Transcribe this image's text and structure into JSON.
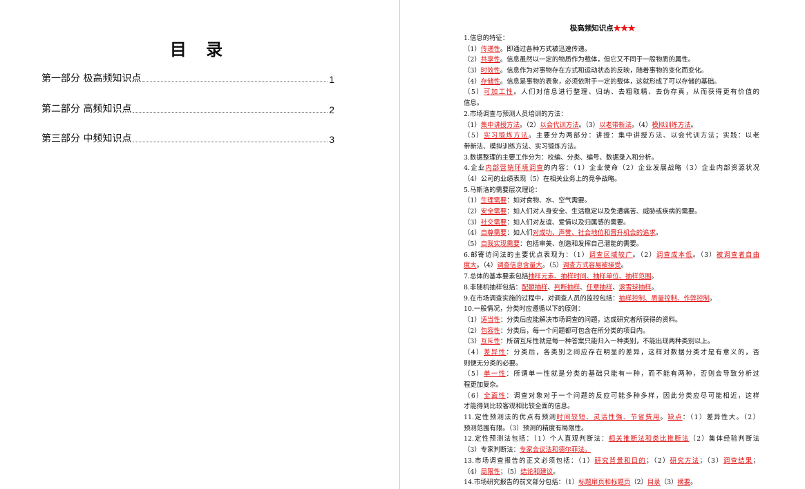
{
  "toc": {
    "title": "目 录",
    "items": [
      {
        "label": "第一部分  极高频知识点",
        "page": "1"
      },
      {
        "label": "第二部分  高频知识点",
        "page": "2"
      },
      {
        "label": "第三部分  中频知识点",
        "page": "3"
      }
    ]
  },
  "doc": {
    "title": "极高频知识点",
    "stars": "★★★",
    "lines": [
      {
        "segs": [
          [
            "1.信息的特征：",
            0
          ]
        ]
      },
      {
        "segs": [
          [
            "（1）",
            0
          ],
          [
            "传递性",
            1
          ],
          [
            "。即通过各种方式被迅速传递。",
            0
          ]
        ]
      },
      {
        "segs": [
          [
            "（2）",
            0
          ],
          [
            "共享性",
            1
          ],
          [
            "。信息虽然以一定的物质作为载体，但它又不同于一般物质的属性。",
            0
          ]
        ]
      },
      {
        "segs": [
          [
            "（3）",
            0
          ],
          [
            "时效性",
            1
          ],
          [
            "。信息作为对事物存在方式和运动状态的反映，随着事物的变化而变化。",
            0
          ]
        ]
      },
      {
        "segs": [
          [
            "（4）",
            0
          ],
          [
            "存储性",
            1
          ],
          [
            "。信息是事物的表象，必须依附于一定的载体，这就形成了可以存储的基础。",
            0
          ]
        ]
      },
      {
        "segs": [
          [
            "（5）",
            0
          ],
          [
            "可加工性",
            1
          ],
          [
            "。人们对信息进行整理、归纳、去粗取精、去伪存真，从而获得更有价值的",
            0
          ]
        ],
        "j": 1
      },
      {
        "segs": [
          [
            "信息。",
            0
          ]
        ]
      },
      {
        "segs": [
          [
            "2.市场调查与预测人员培训的方法：",
            0
          ]
        ]
      },
      {
        "segs": [
          [
            "（1）",
            0
          ],
          [
            "集中讲授方法",
            1
          ],
          [
            "。（2）",
            0
          ],
          [
            "以会代训方法",
            1
          ],
          [
            "。（3）",
            0
          ],
          [
            "以老带新法",
            1
          ],
          [
            "。（4）",
            0
          ],
          [
            "模拟训练方法",
            1
          ],
          [
            "。",
            0
          ]
        ]
      },
      {
        "segs": [
          [
            "（5）",
            0
          ],
          [
            "实习锻炼方法",
            1
          ],
          [
            "。主要分为两部分：讲授：集中讲授方法、以会代训方法；实践：以老",
            0
          ]
        ],
        "j": 1
      },
      {
        "segs": [
          [
            "带新法、模拟训练方法、实习锻炼方法。",
            0
          ]
        ]
      },
      {
        "segs": [
          [
            "3.数据整理的主要工作分为：校编、分类、编号、数据录入和分析。",
            0
          ]
        ]
      },
      {
        "segs": [
          [
            "4.企业",
            0
          ],
          [
            "内部营销环境调查",
            1
          ],
          [
            "的内容：（1）企业使命（2）企业发展战略（3）企业内部资源状况",
            0
          ]
        ],
        "j": 1
      },
      {
        "segs": [
          [
            "（4）公司的业绩表现（5）在相关业务上的竞争战略。",
            0
          ]
        ]
      },
      {
        "segs": [
          [
            "5.马斯洛的需要层次理论：",
            0
          ]
        ]
      },
      {
        "segs": [
          [
            "（1）",
            0
          ],
          [
            "生理需要",
            1
          ],
          [
            "：如对食物、水、空气需要。",
            0
          ]
        ]
      },
      {
        "segs": [
          [
            "（2）",
            0
          ],
          [
            "安全需要",
            1
          ],
          [
            "：如人们对人身安全、生活稳定以及免遭痛苦、威胁或疾病的需要。",
            0
          ]
        ]
      },
      {
        "segs": [
          [
            "（3）",
            0
          ],
          [
            "社交需要",
            1
          ],
          [
            "：如人们对友谊、爱情以及归属感的需要。",
            0
          ]
        ]
      },
      {
        "segs": [
          [
            "（4）",
            0
          ],
          [
            "自尊需要",
            1
          ],
          [
            "：如人们",
            0
          ],
          [
            "对成功、声誉、社会地位和晋升机会的追求",
            1
          ],
          [
            "。",
            0
          ]
        ]
      },
      {
        "segs": [
          [
            "（5）",
            0
          ],
          [
            "自我实现需要",
            1
          ],
          [
            "：包括审美、创造和发挥自己潜能的需要。",
            0
          ]
        ]
      },
      {
        "segs": [
          [
            "6.邮寄访问法的主要优点表现为：（1）",
            0
          ],
          [
            "调查区域较广",
            1
          ],
          [
            "。（2）",
            0
          ],
          [
            "调查成本低",
            1
          ],
          [
            "。（3）",
            0
          ],
          [
            "被调查者自由",
            1
          ]
        ],
        "j": 1
      },
      {
        "segs": [
          [
            "度大",
            1
          ],
          [
            "。（4）",
            0
          ],
          [
            "调查信息含量大",
            1
          ],
          [
            "。（5）",
            0
          ],
          [
            "调查方式容易被接受",
            1
          ],
          [
            "。",
            0
          ]
        ]
      },
      {
        "segs": [
          [
            "7.总体的基本要素包括",
            0
          ],
          [
            "抽样元素、抽样时间、抽样单位、抽样范围",
            1
          ],
          [
            "。",
            0
          ]
        ]
      },
      {
        "segs": [
          [
            "8.非随机抽样包括：",
            0
          ],
          [
            "配额抽样",
            1
          ],
          [
            "、",
            0
          ],
          [
            "判断抽样",
            1
          ],
          [
            "、",
            0
          ],
          [
            "任意抽样",
            1
          ],
          [
            "、",
            0
          ],
          [
            "滚雪球抽样",
            1
          ],
          [
            "。",
            0
          ]
        ]
      },
      {
        "segs": [
          [
            "9.在市场调查实施的过程中，对调查人员的监控包括：",
            0
          ],
          [
            "抽样控制、质量控制、作弊控制",
            1
          ],
          [
            "。",
            0
          ]
        ]
      },
      {
        "segs": [
          [
            "10.一般情况，分类时应遵循以下的原则：",
            0
          ]
        ]
      },
      {
        "segs": [
          [
            "（1）",
            0
          ],
          [
            "适当性",
            1
          ],
          [
            "：分类后应能解决市场调查的问题，达成研究者所获得的资料。",
            0
          ]
        ]
      },
      {
        "segs": [
          [
            "（2）",
            0
          ],
          [
            "包容性",
            1
          ],
          [
            "：分类后，每一个问题都可包含在所分类的项目内。",
            0
          ]
        ]
      },
      {
        "segs": [
          [
            "（3）",
            0
          ],
          [
            "互斥性",
            1
          ],
          [
            "：所谓互斥性就是每一种答案只能归入一种类别，不能出现两种类别以上。",
            0
          ]
        ]
      },
      {
        "segs": [
          [
            "（4）",
            0
          ],
          [
            "差异性",
            1
          ],
          [
            "：分类后，各类别之间应存在明显的差异，这样对数据分类才是有意义的，否",
            0
          ]
        ],
        "j": 1
      },
      {
        "segs": [
          [
            "则便无分类的必要。",
            0
          ]
        ]
      },
      {
        "segs": [
          [
            "（5）",
            0
          ],
          [
            "单一性",
            1
          ],
          [
            "：所谓单一性就是分类的基础只能有一种，而不能有两种，否则会导致分析过",
            0
          ]
        ],
        "j": 1
      },
      {
        "segs": [
          [
            "程更加复杂。",
            0
          ]
        ]
      },
      {
        "segs": [
          [
            "（6）",
            0
          ],
          [
            "全面性",
            1
          ],
          [
            "：调查对象对于一个问题的反应可能多种多样，因此分类应尽可能相近，这样",
            0
          ]
        ],
        "j": 1
      },
      {
        "segs": [
          [
            "才能得到比较客观和比较全面的信息。",
            0
          ]
        ]
      },
      {
        "segs": [
          [
            "11.定性预测法的优点有预测",
            0
          ],
          [
            "时间较短、灵活性强、节省费用",
            1
          ],
          [
            "。",
            0
          ],
          [
            "缺点",
            1
          ],
          [
            "：（1）差异性大。（2）",
            0
          ]
        ],
        "j": 1
      },
      {
        "segs": [
          [
            "预测范围有限。（3）预测的精度有局限性。",
            0
          ]
        ]
      },
      {
        "segs": [
          [
            "12.定性预测法包括：（1）个人直观判断法：",
            0
          ],
          [
            "相关推断法和类比推断法",
            1
          ],
          [
            "（2）集体经验判断法",
            0
          ]
        ],
        "j": 1
      },
      {
        "segs": [
          [
            "（3）专家判断法：",
            0
          ],
          [
            "专家会议法和德尔菲法。",
            1
          ]
        ]
      },
      {
        "segs": [
          [
            "13.市场调查报告的正文必须包括：（1）",
            0
          ],
          [
            "研究背景和目的",
            1
          ],
          [
            "；（2）",
            0
          ],
          [
            "研究方法",
            1
          ],
          [
            "；（3）",
            0
          ],
          [
            "调查结果",
            1
          ],
          [
            "；",
            0
          ]
        ],
        "j": 1
      },
      {
        "segs": [
          [
            "（4）",
            0
          ],
          [
            "局限性",
            1
          ],
          [
            "；（5）",
            0
          ],
          [
            "结论和建议",
            1
          ],
          [
            "。",
            0
          ]
        ]
      },
      {
        "segs": [
          [
            "14.市场研究报告的前文部分包括：（1）",
            0
          ],
          [
            "标题扉页和标题页",
            1
          ],
          [
            "（2）",
            0
          ],
          [
            "目录",
            1
          ],
          [
            "（3）",
            0
          ],
          [
            "摘要",
            1
          ],
          [
            "。",
            0
          ]
        ]
      }
    ]
  }
}
